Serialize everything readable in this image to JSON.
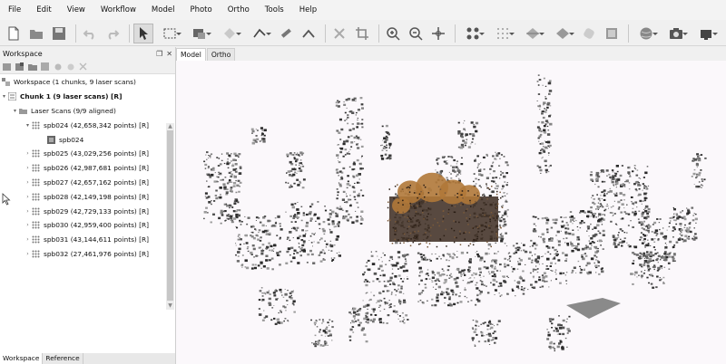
{
  "menu": [
    "File",
    "Edit",
    "View",
    "Workflow",
    "Model",
    "Photo",
    "Ortho",
    "Tools",
    "Help"
  ],
  "panel": {
    "title": "Workspace",
    "workspace_label": "Workspace (1 chunks, 9 laser scans)",
    "chunk_label": "Chunk 1 (9 laser scans) [R]",
    "group_label": "Laser Scans (9/9 aligned)",
    "scans": [
      "spb024 (42,658,342 points) [R]",
      "spb025 (43,029,256 points) [R]",
      "spb026 (42,987,681 points) [R]",
      "spb027 (42,657,162 points) [R]",
      "spb028 (42,149,198 points) [R]",
      "spb029 (42,729,133 points) [R]",
      "spb030 (42,959,400 points) [R]",
      "spb031 (43,144,611 points) [R]",
      "spb032 (27,461,976 points) [R]"
    ],
    "sub_item": "spb024",
    "tabs": [
      "Workspace",
      "Reference"
    ]
  },
  "view_tabs": [
    "Model",
    "Ortho"
  ],
  "icons": [
    "new-icon",
    "open-icon",
    "save-icon",
    "undo-icon",
    "redo-icon",
    "select-icon",
    "rect-select-icon",
    "paint-select-icon",
    "shape-icon",
    "polyline-icon",
    "ruler-icon",
    "crop-icon",
    "delete-icon",
    "zoom-in-icon",
    "zoom-out-icon",
    "move-icon",
    "points-icon",
    "grid-icon",
    "model-icon",
    "shaded-icon",
    "texture-icon",
    "dem-icon",
    "globe-icon",
    "camera-icon",
    "camera-mode-icon"
  ],
  "colors": {
    "accent": "#3c6fc0",
    "background": "#fbf8fb",
    "dome": "#b07838"
  }
}
